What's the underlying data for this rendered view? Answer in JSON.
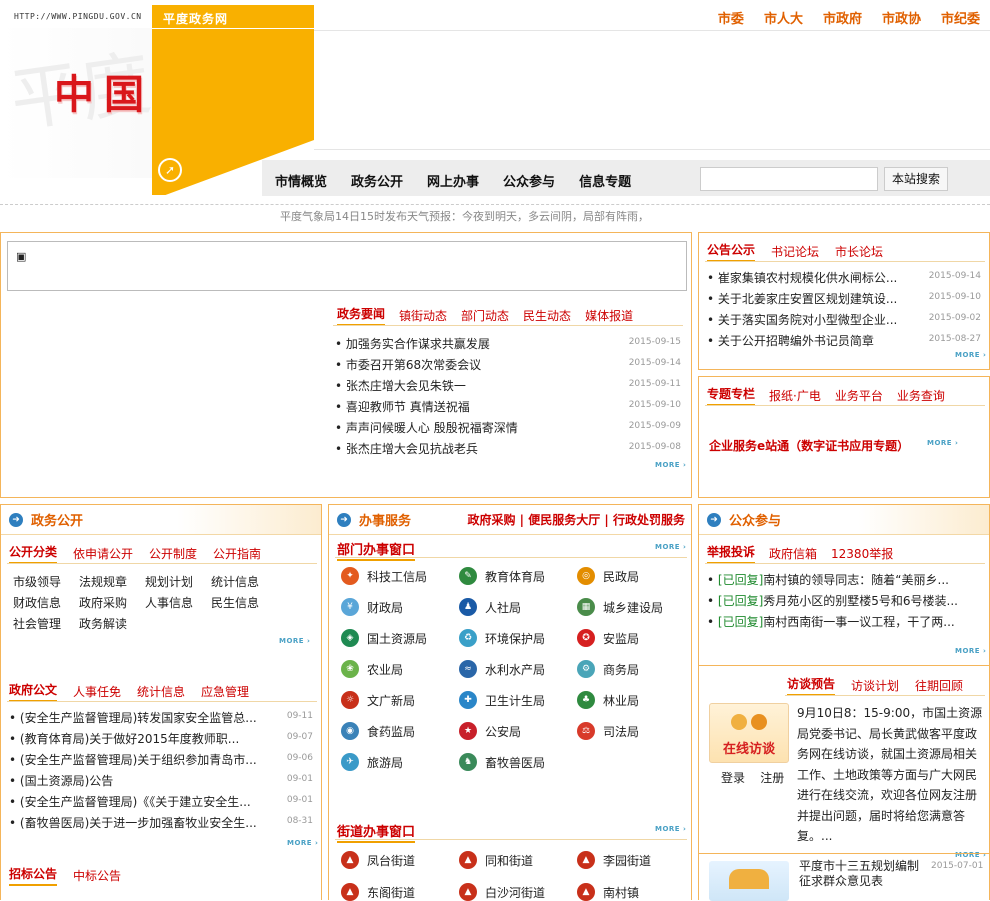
{
  "header": {
    "url": "HTTP://WWW.PINGDU.GOV.CN",
    "site_label": "平度政务网",
    "title": "中国平度",
    "calligraphy": "平度",
    "top_links": [
      "市委",
      "市人大",
      "市政府",
      "市政协",
      "市纪委"
    ],
    "nav": [
      "市情概览",
      "政务公开",
      "网上办事",
      "公众参与",
      "信息专题"
    ],
    "search_button": "本站搜索",
    "weather": "平度气象局14日15时发布天气预报：今夜到明天，多云间阴，局部有阵雨，"
  },
  "news_box": {
    "tabs": [
      "政务要闻",
      "镇街动态",
      "部门动态",
      "民生动态",
      "媒体报道"
    ],
    "items": [
      {
        "title": "加强务实合作谋求共赢发展",
        "date": "2015-09-15"
      },
      {
        "title": "市委召开第68次常委会议",
        "date": "2015-09-14"
      },
      {
        "title": "张杰庄增大会见朱铁一",
        "date": "2015-09-11"
      },
      {
        "title": "喜迎教师节 真情送祝福",
        "date": "2015-09-10"
      },
      {
        "title": "声声问候暖人心 殷殷祝福寄深情",
        "date": "2015-09-09"
      },
      {
        "title": "张杰庄增大会见抗战老兵",
        "date": "2015-09-08"
      }
    ],
    "more": "MORE"
  },
  "notice_box": {
    "tabs": [
      "公告公示",
      "书记论坛",
      "市长论坛"
    ],
    "items": [
      {
        "title": "崔家集镇农村规模化供水闸标公...",
        "date": "2015-09-14"
      },
      {
        "title": "关于北姜家庄安置区规划建筑设...",
        "date": "2015-09-10"
      },
      {
        "title": "关于落实国务院对小型微型企业...",
        "date": "2015-09-02"
      },
      {
        "title": "关于公开招聘编外书记员简章",
        "date": "2015-08-27"
      }
    ],
    "more": "MORE"
  },
  "topic_box": {
    "tabs": [
      "专题专栏",
      "报纸·广电",
      "业务平台",
      "业务查询"
    ],
    "feature": "企业服务e站通（数字证书应用专题）",
    "more": "MORE"
  },
  "gov_open": {
    "title": "政务公开",
    "tabs": [
      "公开分类",
      "依申请公开",
      "公开制度",
      "公开指南"
    ],
    "grid": [
      "市级领导",
      "法规规章",
      "规划计划",
      "统计信息",
      "财政信息",
      "政府采购",
      "人事信息",
      "民生信息",
      "社会管理",
      "政务解读"
    ],
    "more": "MORE",
    "tabs2": [
      "政府公文",
      "人事任免",
      "统计信息",
      "应急管理"
    ],
    "docs": [
      {
        "title": "(安全生产监督管理局)转发国家安全监管总...",
        "date": "09-11"
      },
      {
        "title": "(教育体育局)关于做好2015年度教师职...",
        "date": "09-07"
      },
      {
        "title": "(安全生产监督管理局)关于组织参加青岛市...",
        "date": "09-06"
      },
      {
        "title": "(国土资源局)公告",
        "date": "09-01"
      },
      {
        "title": "(安全生产监督管理局)《《关于建立安全生...",
        "date": "09-01"
      },
      {
        "title": "(畜牧兽医局)关于进一步加强畜牧业安全生...",
        "date": "08-31"
      }
    ],
    "more2": "MORE",
    "tabs3": [
      "招标公告",
      "中标公告"
    ]
  },
  "services": {
    "title": "办事服务",
    "links": [
      "政府采购",
      "便民服务大厅",
      "行政处罚服务"
    ],
    "dept_title": "部门办事窗口",
    "depts": [
      "科技工信局",
      "教育体育局",
      "民政局",
      "财政局",
      "人社局",
      "城乡建设局",
      "国土资源局",
      "环境保护局",
      "安监局",
      "农业局",
      "水利水产局",
      "商务局",
      "文广新局",
      "卫生计生局",
      "林业局",
      "食药监局",
      "公安局",
      "司法局",
      "旅游局",
      "畜牧兽医局"
    ],
    "street_title": "街道办事窗口",
    "streets": [
      "凤台街道",
      "同和街道",
      "李园街道",
      "东阁街道",
      "白沙河街道",
      "南村镇"
    ],
    "more": "MORE"
  },
  "public": {
    "title": "公众参与",
    "tabs": [
      "举报投诉",
      "政府信箱",
      "12380举报"
    ],
    "replied": "[已回复]",
    "items": [
      "南村镇的领导同志：随着“美丽乡...",
      "秀月苑小区的别墅楼5号和6号楼装...",
      "南村西南街一事一议工程，干了两..."
    ],
    "more": "MORE",
    "tabs2": [
      "访谈预告",
      "访谈计划",
      "往期回顾"
    ],
    "badge": "在线访谈",
    "login": "登录",
    "register": "注册",
    "interview": "9月10日8：15-9:00，市国土资源局党委书记、局长黄武做客平度政务网在线访谈，就国土资源局相关工作、土地政策等方面与广大网民进行在线交流，欢迎各位网友注册并提出问题，届时将给您满意答复。...",
    "survey": "平度市十三五规划编制征求群众意见表",
    "survey_date": "2015-07-01"
  },
  "colors": {
    "accent": "#f9b000",
    "red": "#c00",
    "orange": "#e06000",
    "border": "#f4b55a"
  }
}
